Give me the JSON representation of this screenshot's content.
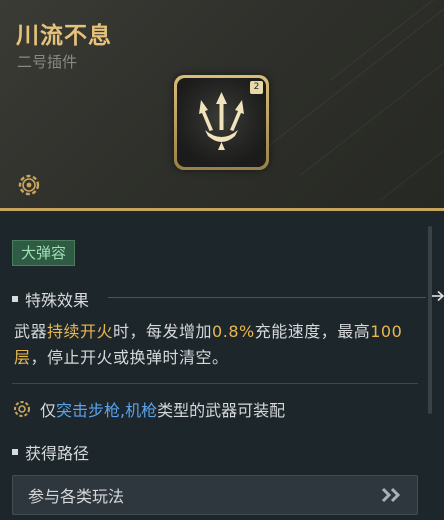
{
  "header": {
    "title": "川流不息",
    "subtitle": "二号插件",
    "item_badge": "2",
    "item_icon": "trident-arrows-icon"
  },
  "tag": "大弹容",
  "special_effect": {
    "heading": "特殊效果",
    "desc_parts": [
      "武器",
      "持续开火",
      "时，每发增加",
      "0.8%",
      "充能速度，最高",
      "100层",
      "，停止开火或换弹时清空。"
    ]
  },
  "equip_restriction": {
    "prefix": "仅",
    "weapons": "突击步枪,机枪",
    "suffix": "类型的武器可装配"
  },
  "source": {
    "heading": "获得路径",
    "button_label": "参与各类玩法",
    "button_icon": "double-chevron-right-icon"
  },
  "colors": {
    "title_gold": "#e7c27a",
    "highlight_yellow": "#e8b84f",
    "highlight_blue": "#5aa2ec",
    "tag_green": "#2f5a44"
  }
}
